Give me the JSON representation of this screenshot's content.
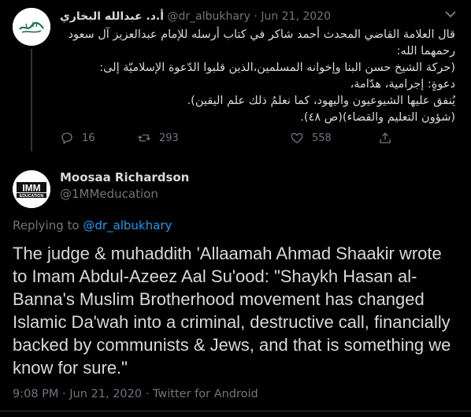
{
  "top_tweet": {
    "name": "أ.د. عبدالله البخاري",
    "handle": "@dr_albukhary",
    "date": "Jun 21, 2020",
    "body_lines": [
      "قال العلامة القاضي المحدث أحمد شاكر في كتاب أرسله للإمام عبدالعزيز آل سعود",
      "رحمهما الله:",
      "(حركة الشيخ حسن البنا وإخوانه المسلمين،الذين قلبوا الدّعوة الإسلاميّة إلى:",
      "دعوةٍ: إجرامية، هدّامة،",
      "يُنفق عليها الشيوعيون واليهود، كما نعلمُ ذلك علم اليقين).",
      "(شؤون التعليم والقضاء)(ص ٤٨)."
    ],
    "replies": "16",
    "retweets": "293",
    "likes": "558",
    "icons": [
      "reply-icon",
      "retweet-icon",
      "like-icon",
      "share-icon",
      "more-icon"
    ]
  },
  "main_tweet": {
    "name": "Moosaa Richardson",
    "handle": "@1MMeducation",
    "avatar_lines": [
      "IMM",
      "EDUCATION"
    ],
    "replying_label": "Replying to",
    "replying_handle": "@dr_albukhary",
    "text": "The judge & muhaddith 'Allaamah Ahmad Shaakir wrote to Imam Abdul-Azeez Aal Su'ood: \"Shaykh Hasan al-Banna's Muslim Brotherhood movement has changed Islamic Da'wah into a criminal, destructive call, financially backed by communists & Jews, and that is something we know for sure.\"",
    "time": "9:08 PM",
    "date": "Jun 21, 2020",
    "source": "Twitter for Android"
  },
  "colors": {
    "background": "#000000",
    "text": "#d9d9d9",
    "muted": "#6e767d",
    "link": "#1d9bf0",
    "divider": "#2f3336"
  }
}
